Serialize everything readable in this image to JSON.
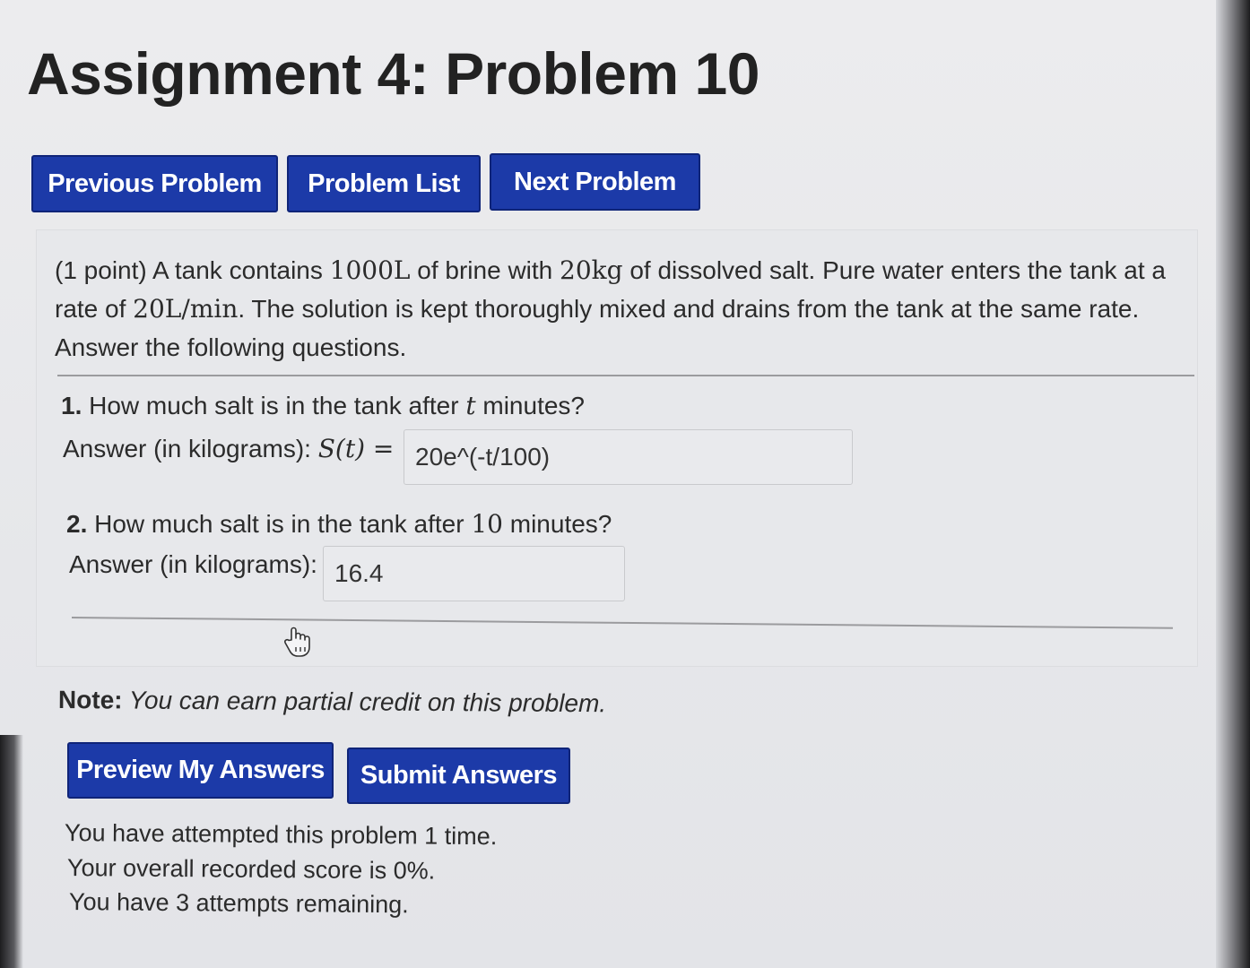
{
  "page": {
    "title": "Assignment 4: Problem 10"
  },
  "nav": {
    "previous_label": "Previous Problem",
    "list_label": "Problem List",
    "next_label": "Next Problem"
  },
  "problem": {
    "points": "(1 point)",
    "text_1": " A tank contains ",
    "volume": "1000L",
    "text_2": " of brine with ",
    "salt": "20kg",
    "text_3": " of dissolved salt. Pure water enters the tank at a rate of ",
    "rate": "20L/min",
    "text_4": ". The solution is kept thoroughly mixed and drains from the tank at the same rate. Answer the following questions.",
    "questions": [
      {
        "number": "1.",
        "text_before": " How much salt is in the tank after ",
        "math": "t",
        "text_after": " minutes?",
        "answer_label": "Answer (in kilograms): ",
        "answer_math": "S(t) =",
        "answer_value": "20e^(-t/100)"
      },
      {
        "number": "2.",
        "text_before": " How much salt is in the tank after ",
        "math": "10",
        "text_after": " minutes?",
        "answer_label": "Answer (in kilograms):",
        "answer_value": "16.4"
      }
    ]
  },
  "note": {
    "label": "Note:",
    "text": " You can earn partial credit on this problem."
  },
  "actions": {
    "preview_label": "Preview My Answers",
    "submit_label": "Submit Answers"
  },
  "status": {
    "attempts": "You have attempted this problem 1 time.",
    "score": "Your overall recorded score is 0%.",
    "remaining": "You have 3 attempts remaining."
  },
  "icons": {
    "cursor": "hand-pointer-icon"
  },
  "colors": {
    "button_bg": "#1c3aa8",
    "button_text": "#ffffff"
  }
}
